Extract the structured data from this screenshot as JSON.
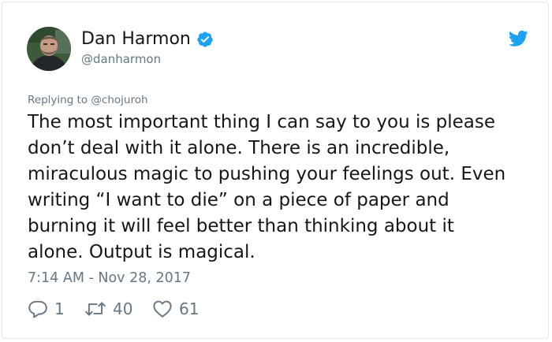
{
  "tweet": {
    "author": {
      "display_name": "Dan Harmon",
      "handle": "@danharmon",
      "verified": true
    },
    "replying_to": "Replying to @chojuroh",
    "text_lines": [
      "The most important thing I can say to you is please",
      "don’t deal with it alone. There is an incredible,",
      "miraculous magic to pushing your feelings out. Even",
      "writing “I want to die” on a piece of paper and",
      "burning it will feel better than thinking about it",
      "alone. Output is magical."
    ],
    "timestamp": "7:14 AM - Nov 28, 2017",
    "stats": {
      "replies": "1",
      "retweets": "40",
      "likes": "61"
    }
  },
  "icons": {
    "brand": "twitter-bird-icon",
    "verified": "verified-badge-icon",
    "reply": "reply-icon",
    "retweet": "retweet-icon",
    "like": "heart-icon"
  },
  "colors": {
    "brand_blue": "#1da1f2",
    "text_primary": "#14171a",
    "text_secondary": "#657786",
    "border": "#e1e8ed"
  }
}
